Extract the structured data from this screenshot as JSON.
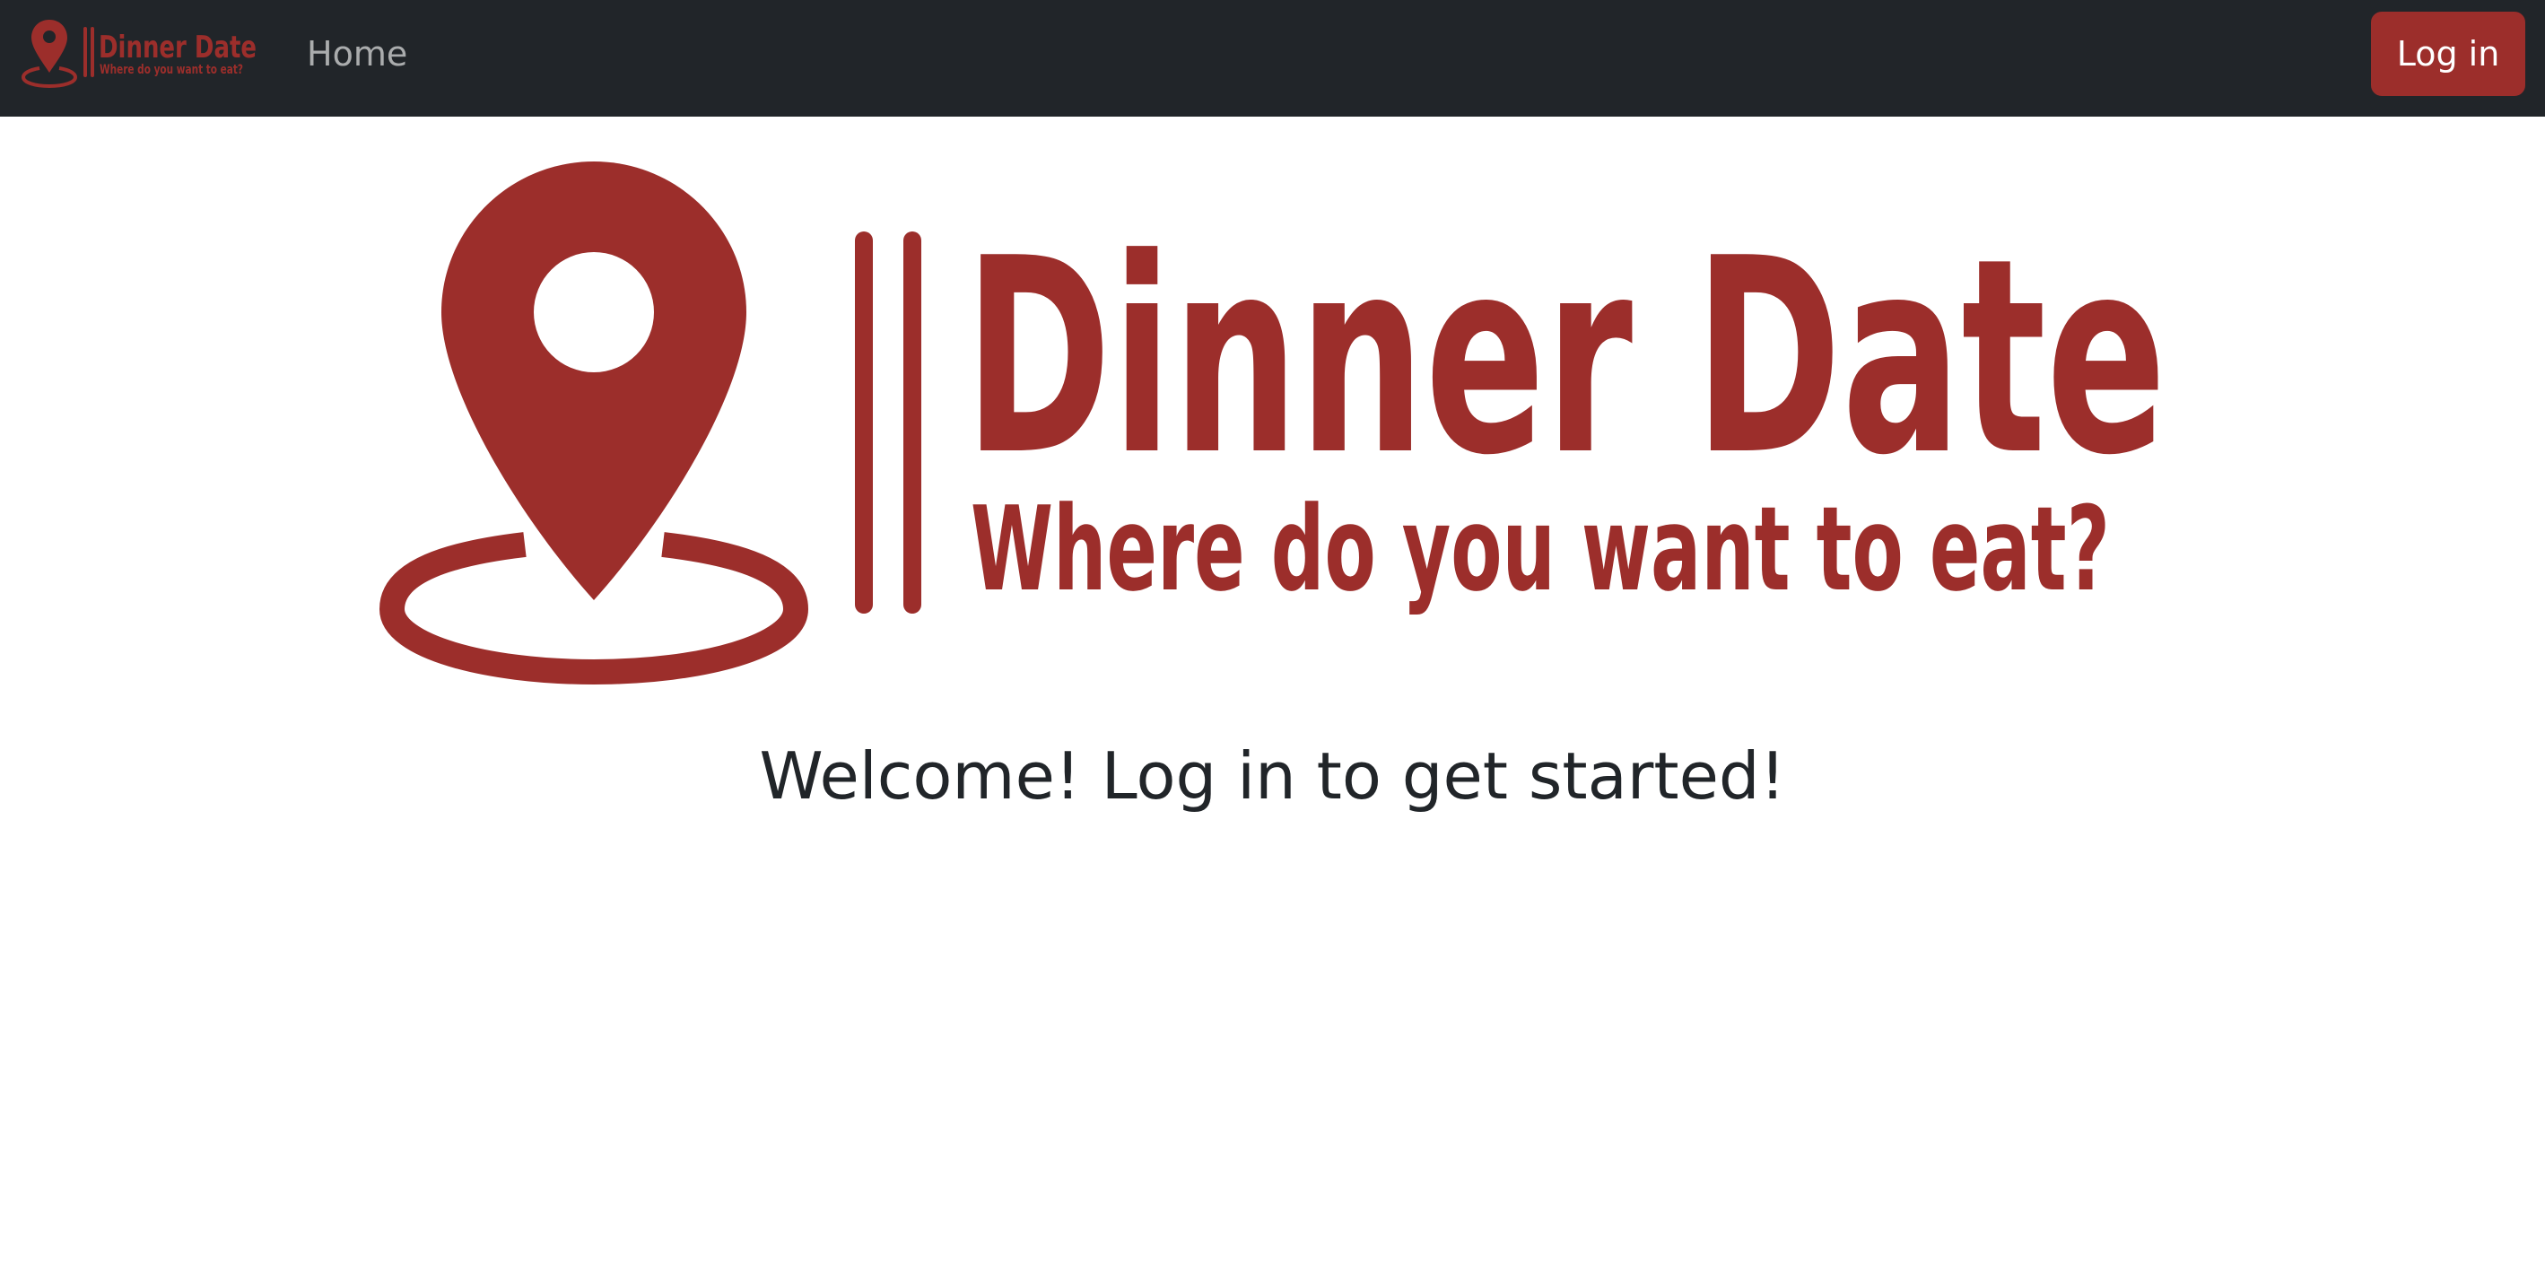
{
  "navbar": {
    "brand": {
      "title": "Dinner Date",
      "tagline": "Where do you want to eat?"
    },
    "home_label": "Home",
    "login_label": "Log in"
  },
  "hero": {
    "logo": {
      "title": "Dinner Date",
      "tagline": "Where do you want to eat?"
    },
    "welcome": "Welcome! Log in to get started!"
  },
  "colors": {
    "brand_red": "#9c2e2b",
    "navbar_bg": "#212529",
    "text_dark": "#212529"
  },
  "icons": {
    "logo": "map-pin-icon"
  }
}
